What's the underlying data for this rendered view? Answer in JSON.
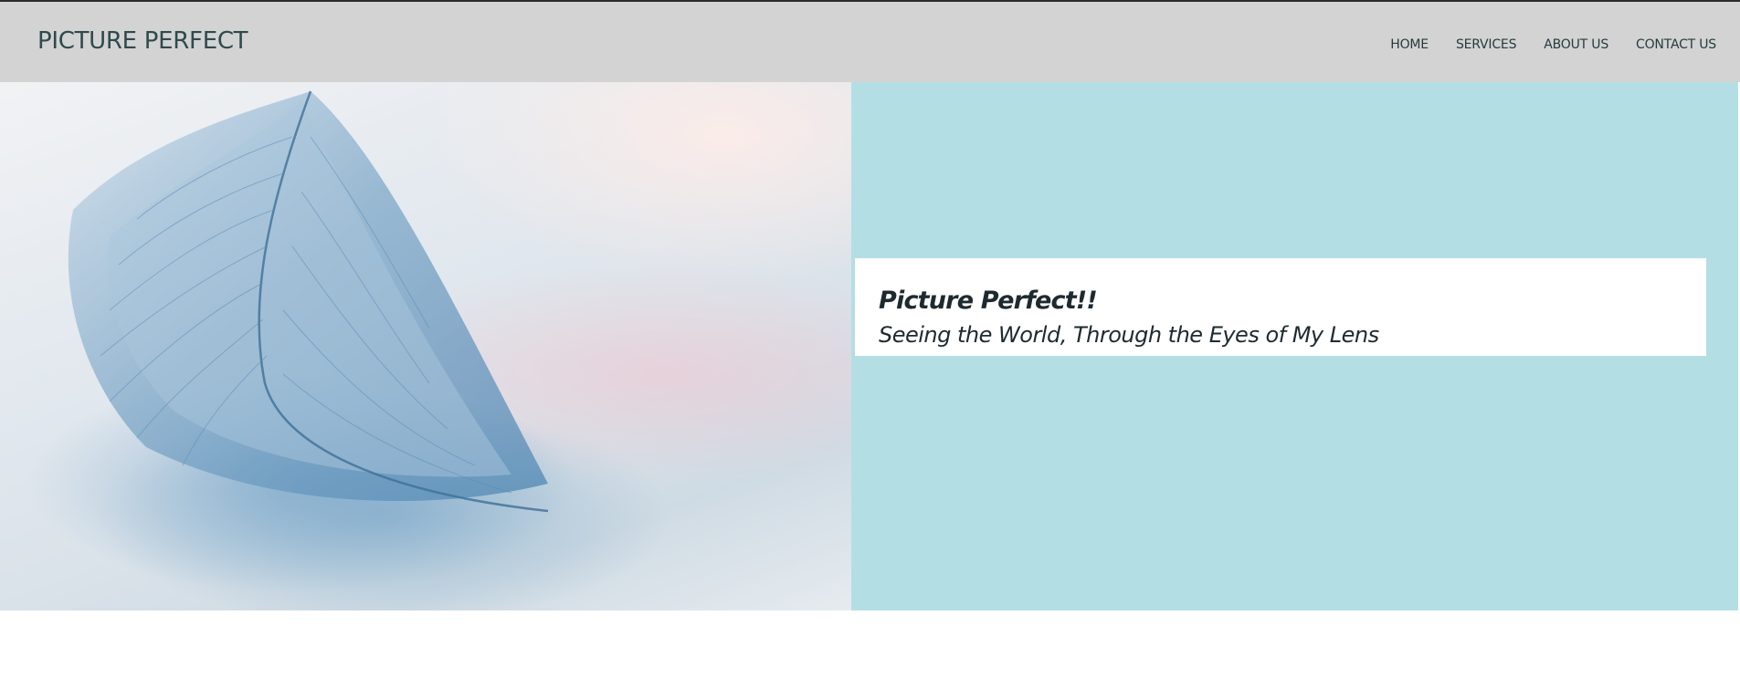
{
  "navbar": {
    "brand": "PICTURE PERFECT",
    "links": [
      {
        "label": "HOME"
      },
      {
        "label": "SERVICES"
      },
      {
        "label": "ABOUT US"
      },
      {
        "label": "CONTACT US"
      }
    ]
  },
  "hero": {
    "image_subject": "blue feather on soft pastel background",
    "title": "Picture Perfect!!",
    "subtitle": "Seeing the World, Through the Eyes of My Lens"
  },
  "colors": {
    "navbar_bg": "#d3d3d3",
    "brand_text": "#2f4a4c",
    "hero_panel_bg": "#b3dfe4",
    "caption_bg": "#ffffff",
    "caption_text": "#1e2a2f"
  }
}
